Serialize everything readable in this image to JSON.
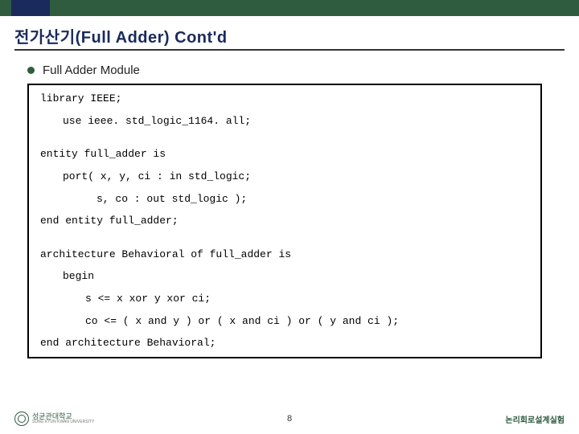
{
  "title": "전가산기(Full Adder) Cont'd",
  "bullet": "Full Adder Module",
  "code": {
    "l1": "library IEEE;",
    "l2": "use ieee. std_logic_1164. all;",
    "l3": "entity full_adder is",
    "l4": "port( x, y, ci : in std_logic;",
    "l5": "s, co : out std_logic );",
    "l6": "end entity full_adder;",
    "l7": "architecture Behavioral of full_adder is",
    "l8": "begin",
    "l9": "s <= x xor y xor ci;",
    "l10": "co <= ( x and y ) or ( x and ci ) or ( y and ci );",
    "l11": "end architecture Behavioral;"
  },
  "footer": {
    "uni": "성균관대학교",
    "uni_sub": "SUNG KYUN KWAN UNIVERSITY",
    "page": "8",
    "right": "논리회로설계실험"
  }
}
